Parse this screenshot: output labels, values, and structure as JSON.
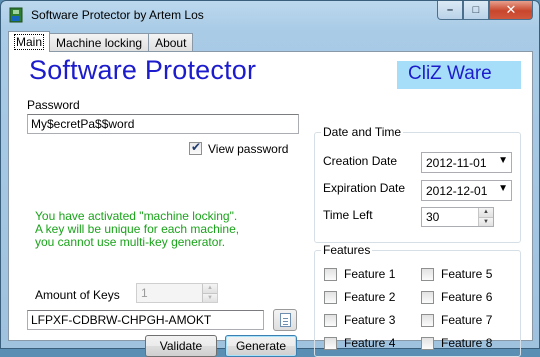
{
  "window": {
    "title": "Software Protector by Artem Los",
    "minimize_glyph": "–",
    "maximize_glyph": "□",
    "close_glyph": "✕"
  },
  "tabs": [
    {
      "label": "Main",
      "active": true
    },
    {
      "label": "Machine locking",
      "active": false
    },
    {
      "label": "About",
      "active": false
    }
  ],
  "banner": {
    "title": "Software Protector",
    "logo_text": "CliZ Ware"
  },
  "password": {
    "label": "Password",
    "value": "My$ecretPa$$word",
    "view_label": "View password",
    "view_checked": true
  },
  "notice": {
    "line1": "You have activated \"machine locking\".",
    "line2": "A key will be unique for each machine,",
    "line3": "you cannot use multi-key generator."
  },
  "keys": {
    "amount_label": "Amount of Keys",
    "amount_value": "1",
    "key_value": "LFPXF-CDBRW-CHPGH-AMOKT",
    "validate_label": "Validate",
    "generate_label": "Generate"
  },
  "datetime": {
    "group_title": "Date and Time",
    "creation_label": "Creation Date",
    "creation_value": "2012-11-01",
    "expiration_label": "Expiration Date",
    "expiration_value": "2012-12-01",
    "time_left_label": "Time Left",
    "time_left_value": "30"
  },
  "features": {
    "group_title": "Features",
    "items": [
      {
        "label": "Feature 1",
        "checked": false
      },
      {
        "label": "Feature 2",
        "checked": false
      },
      {
        "label": "Feature 3",
        "checked": false
      },
      {
        "label": "Feature 4",
        "checked": false
      },
      {
        "label": "Feature 5",
        "checked": false
      },
      {
        "label": "Feature 6",
        "checked": false
      },
      {
        "label": "Feature 7",
        "checked": false
      },
      {
        "label": "Feature 8",
        "checked": false
      }
    ]
  },
  "colors": {
    "brand_title": "#1c1ccd",
    "logo_bg": "#a6defa",
    "notice_text": "#1aa31a"
  }
}
